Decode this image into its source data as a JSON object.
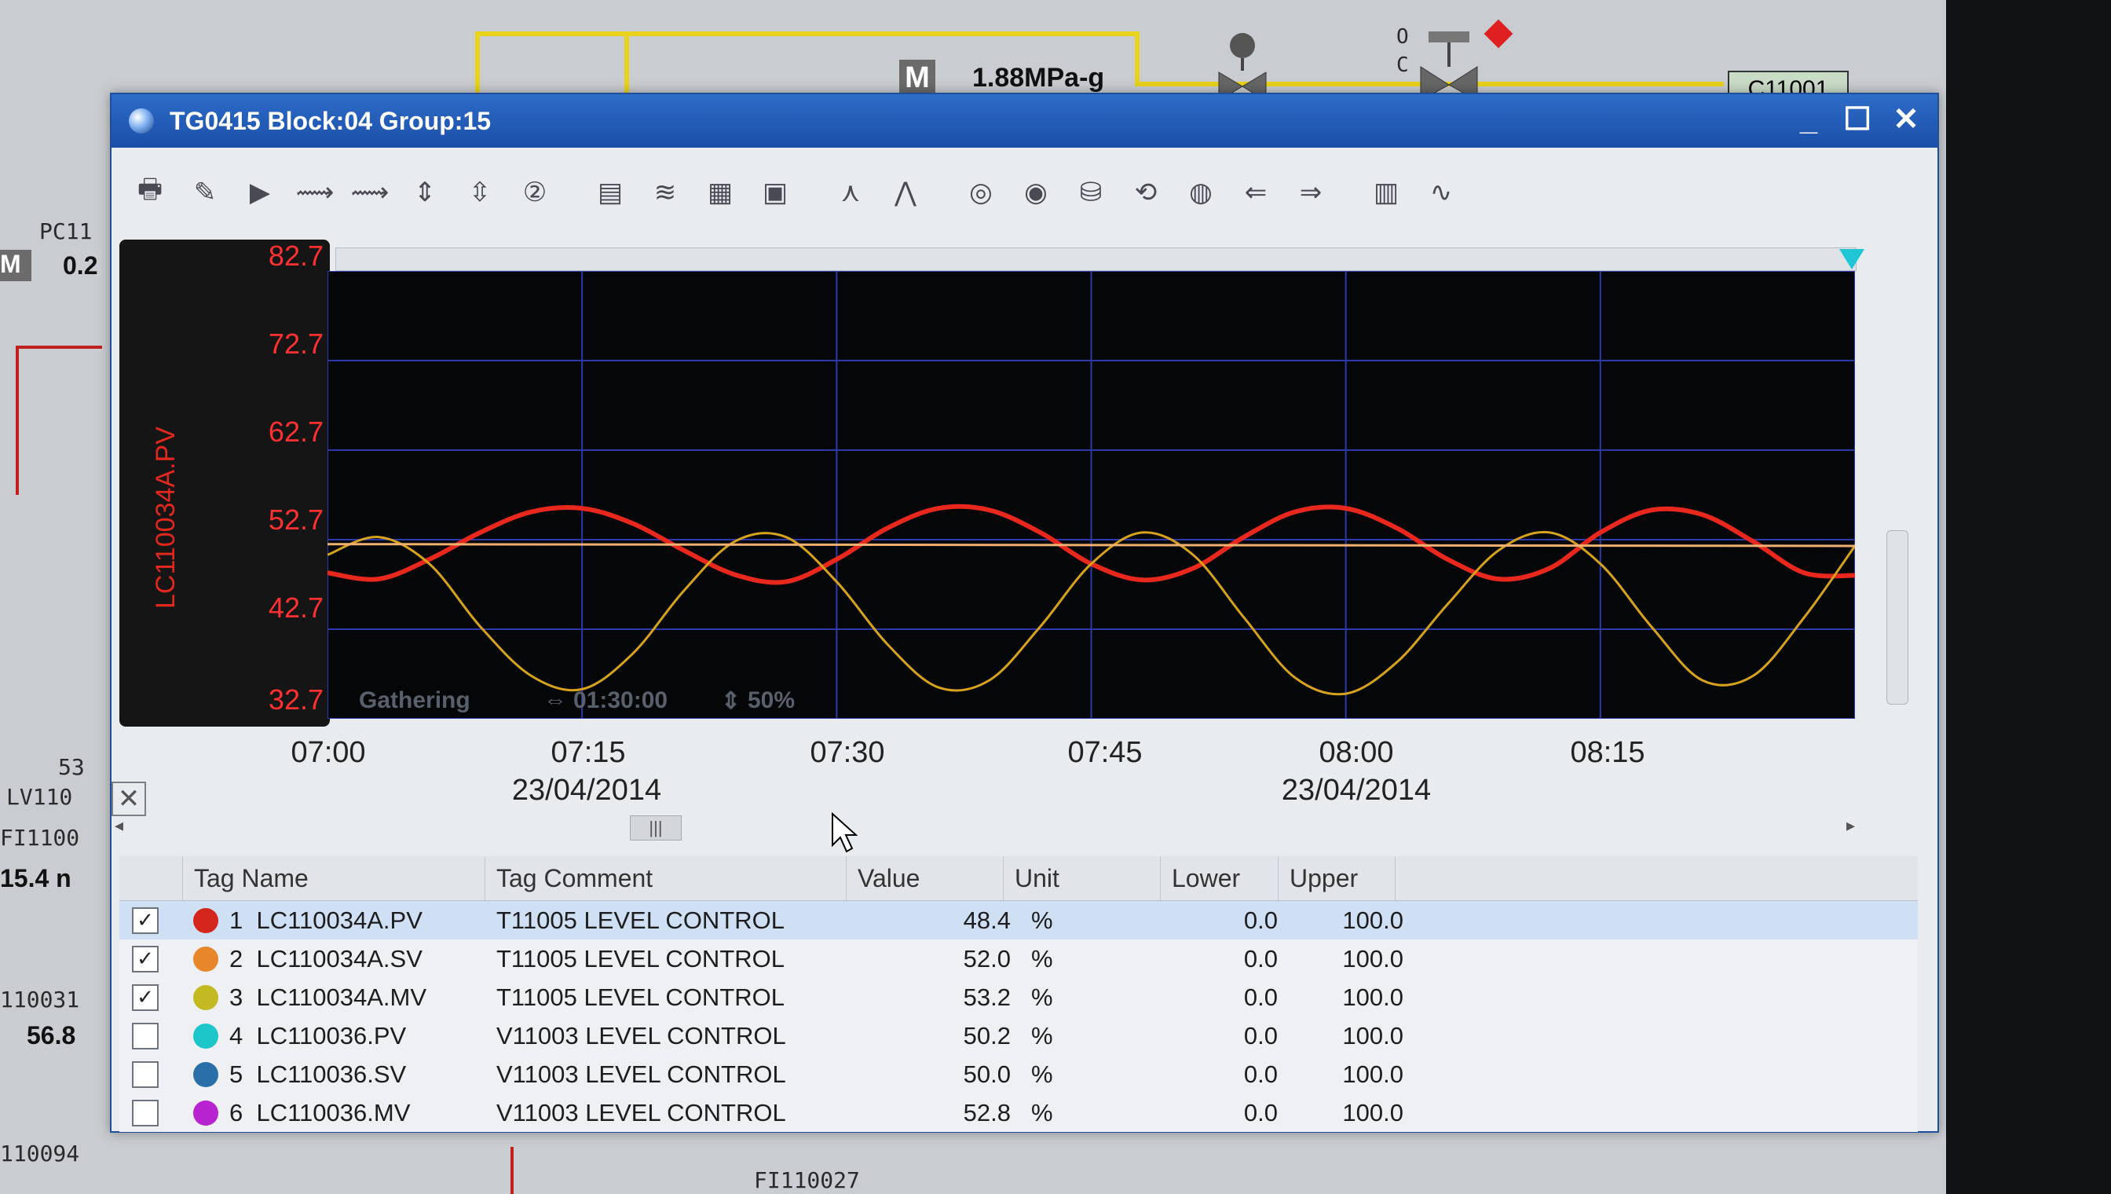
{
  "background": {
    "mode_box_label": "M",
    "pressure_readout": "1.88MPa-g",
    "tag_c11001": "C11001",
    "valve_open_label": "O",
    "valve_closed_label": "C",
    "left_tags": [
      "PC11",
      "0.2",
      "53",
      "LV110",
      "FI1100",
      "15.4 n",
      "110031",
      "56.8",
      "110094",
      "FI110027"
    ]
  },
  "window": {
    "title": "TG0415 Block:04 Group:15",
    "minimize_label": "_",
    "maximize_label": "☐",
    "close_label": "✕"
  },
  "toolbar": {
    "icons": [
      "print-icon",
      "pen-trend-icon",
      "play-trend-icon",
      "zoom-in-trend-icon",
      "zoom-out-trend-icon",
      "expand-y-icon",
      "shrink-y-icon",
      "trend-2-icon",
      "add-panel-icon",
      "overlay-trend-icon",
      "compare-trend-icon",
      "monitor-icon",
      "trend-point-icon",
      "trend-cursor-icon",
      "database-icon",
      "database-monitor-icon",
      "multi-database-icon",
      "database-refresh-icon",
      "disk-stack-icon",
      "transfer-left-icon",
      "transfer-right-icon",
      "disk-monitor-icon",
      "wave-icon"
    ]
  },
  "chart_data": {
    "type": "line",
    "yaxis_title": "LC110034A.PV",
    "y_ticks": [
      "82.7",
      "72.7",
      "62.7",
      "52.7",
      "42.7",
      "32.7"
    ],
    "ylim": [
      32.7,
      82.7
    ],
    "x_ticks": [
      "07:00",
      "07:15",
      "07:30",
      "07:45",
      "08:00",
      "08:15"
    ],
    "x_dates": [
      "23/04/2014",
      "23/04/2014"
    ],
    "xlim_minutes": [
      0,
      90
    ],
    "gathering_text": "Gathering",
    "span_text": "01:30:00",
    "percent_text": "50%",
    "grid": true,
    "series": [
      {
        "color": "#e8271d",
        "values_minutes": [
          0,
          3,
          6,
          9,
          12,
          15,
          18,
          21,
          24,
          27,
          30,
          33,
          36,
          39,
          42,
          45,
          48,
          51,
          54,
          57,
          60,
          63,
          66,
          69,
          72,
          75,
          78,
          81,
          84,
          87,
          90
        ],
        "values": [
          49,
          48.3,
          50.5,
          53.5,
          55.8,
          56.2,
          54.5,
          51.5,
          48.8,
          48,
          50.5,
          54,
          56.2,
          56,
          53.5,
          50,
          48.2,
          49.5,
          53,
          55.8,
          56.2,
          54,
          50.5,
          48.3,
          49.5,
          53.5,
          56,
          55.5,
          52.5,
          49,
          48.7
        ]
      },
      {
        "color": "#d7a21c",
        "values_minutes": [
          0,
          3,
          6,
          9,
          12,
          15,
          18,
          21,
          24,
          27,
          30,
          33,
          36,
          39,
          42,
          45,
          48,
          51,
          54,
          57,
          60,
          63,
          66,
          69,
          72,
          75,
          78,
          81,
          84,
          87,
          90
        ],
        "values": [
          51,
          53,
          50,
          43,
          37.5,
          36,
          40,
          47,
          52.5,
          53,
          48,
          41,
          36.2,
          37,
          43,
          50,
          53.5,
          51,
          44,
          37.3,
          35.5,
          39,
          45.5,
          51.5,
          53.5,
          50,
          43,
          37,
          37.5,
          44,
          52
        ]
      },
      {
        "color": "#f0b070",
        "values_minutes": [
          0,
          90
        ],
        "values": [
          52.2,
          52.0
        ]
      }
    ]
  },
  "table": {
    "headers": [
      "Tag Name",
      "Tag Comment",
      "Value",
      "Unit",
      "Lower",
      "Upper"
    ],
    "rows": [
      {
        "checked": "✓",
        "color": "#d4261c",
        "no": "1",
        "tag": "LC110034A.PV",
        "comment": "T11005 LEVEL CONTROL",
        "value": "48.4",
        "unit": "%",
        "lower": "0.0",
        "upper": "100.0"
      },
      {
        "checked": "✓",
        "color": "#e8862a",
        "no": "2",
        "tag": "LC110034A.SV",
        "comment": "T11005 LEVEL CONTROL",
        "value": "52.0",
        "unit": "%",
        "lower": "0.0",
        "upper": "100.0"
      },
      {
        "checked": "✓",
        "color": "#c3ba22",
        "no": "3",
        "tag": "LC110034A.MV",
        "comment": "T11005 LEVEL CONTROL",
        "value": "53.2",
        "unit": "%",
        "lower": "0.0",
        "upper": "100.0"
      },
      {
        "checked": "",
        "color": "#1dc6c8",
        "no": "4",
        "tag": "LC110036.PV",
        "comment": "V11003 LEVEL CONTROL",
        "value": "50.2",
        "unit": "%",
        "lower": "0.0",
        "upper": "100.0"
      },
      {
        "checked": "",
        "color": "#2a6fa8",
        "no": "5",
        "tag": "LC110036.SV",
        "comment": "V11003 LEVEL CONTROL",
        "value": "50.0",
        "unit": "%",
        "lower": "0.0",
        "upper": "100.0"
      },
      {
        "checked": "",
        "color": "#b823d0",
        "no": "6",
        "tag": "LC110036.MV",
        "comment": "V11003 LEVEL CONTROL",
        "value": "52.8",
        "unit": "%",
        "lower": "0.0",
        "upper": "100.0"
      }
    ]
  }
}
